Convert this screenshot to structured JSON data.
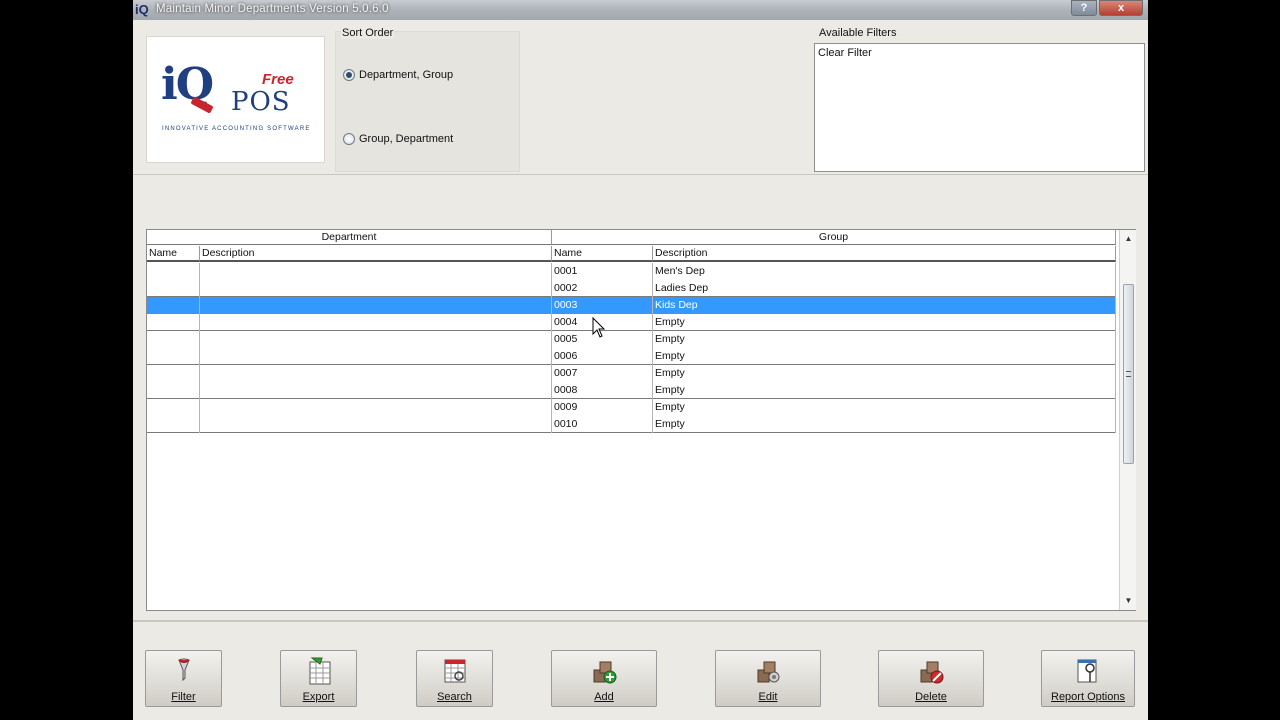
{
  "window": {
    "title": "Maintain Minor Departments Version 5.0.6.0",
    "icon": "iq-app-icon",
    "help_label": "?",
    "close_label": "x"
  },
  "logo": {
    "iq": "iQ",
    "free": "Free",
    "pos": "POS",
    "tagline": "INNOVATIVE ACCOUNTING SOFTWARE"
  },
  "sort_order": {
    "label": "Sort Order",
    "options": [
      {
        "label": "Department, Group",
        "checked": true
      },
      {
        "label": "Group, Department",
        "checked": false
      }
    ]
  },
  "filters": {
    "label": "Available Filters",
    "items": [
      "Clear Filter"
    ]
  },
  "grid": {
    "bands": [
      "Department",
      "Group"
    ],
    "columns": [
      "Name",
      "Description",
      "Name",
      "Description"
    ],
    "rows": [
      {
        "dept_name": "",
        "dept_desc": "",
        "group_name": "0001",
        "group_desc": "Men's Dep",
        "selected": false
      },
      {
        "dept_name": "",
        "dept_desc": "",
        "group_name": "0002",
        "group_desc": "Ladies Dep",
        "selected": false
      },
      {
        "dept_name": "",
        "dept_desc": "",
        "group_name": "0003",
        "group_desc": "Kids Dep",
        "selected": true
      },
      {
        "dept_name": "",
        "dept_desc": "",
        "group_name": "0004",
        "group_desc": "Empty",
        "selected": false
      },
      {
        "dept_name": "",
        "dept_desc": "",
        "group_name": "0005",
        "group_desc": "Empty",
        "selected": false
      },
      {
        "dept_name": "",
        "dept_desc": "",
        "group_name": "0006",
        "group_desc": "Empty",
        "selected": false
      },
      {
        "dept_name": "",
        "dept_desc": "",
        "group_name": "0007",
        "group_desc": "Empty",
        "selected": false
      },
      {
        "dept_name": "",
        "dept_desc": "",
        "group_name": "0008",
        "group_desc": "Empty",
        "selected": false
      },
      {
        "dept_name": "",
        "dept_desc": "",
        "group_name": "0009",
        "group_desc": "Empty",
        "selected": false
      },
      {
        "dept_name": "",
        "dept_desc": "",
        "group_name": "0010",
        "group_desc": "Empty",
        "selected": false
      }
    ]
  },
  "toolbar": {
    "buttons": [
      {
        "label": "Filter",
        "icon": "filter-funnel-icon"
      },
      {
        "label": "Export",
        "icon": "export-spreadsheet-icon"
      },
      {
        "label": "Search",
        "icon": "search-calendar-icon"
      },
      {
        "label": "Add",
        "icon": "add-boxes-icon"
      },
      {
        "label": "Edit",
        "icon": "edit-boxes-icon"
      },
      {
        "label": "Delete",
        "icon": "delete-boxes-icon"
      },
      {
        "label": "Report Options",
        "icon": "report-options-icon"
      }
    ]
  },
  "colors": {
    "selection": "#3399ff",
    "logo_blue": "#1f3f80",
    "logo_red": "#c8262c"
  }
}
